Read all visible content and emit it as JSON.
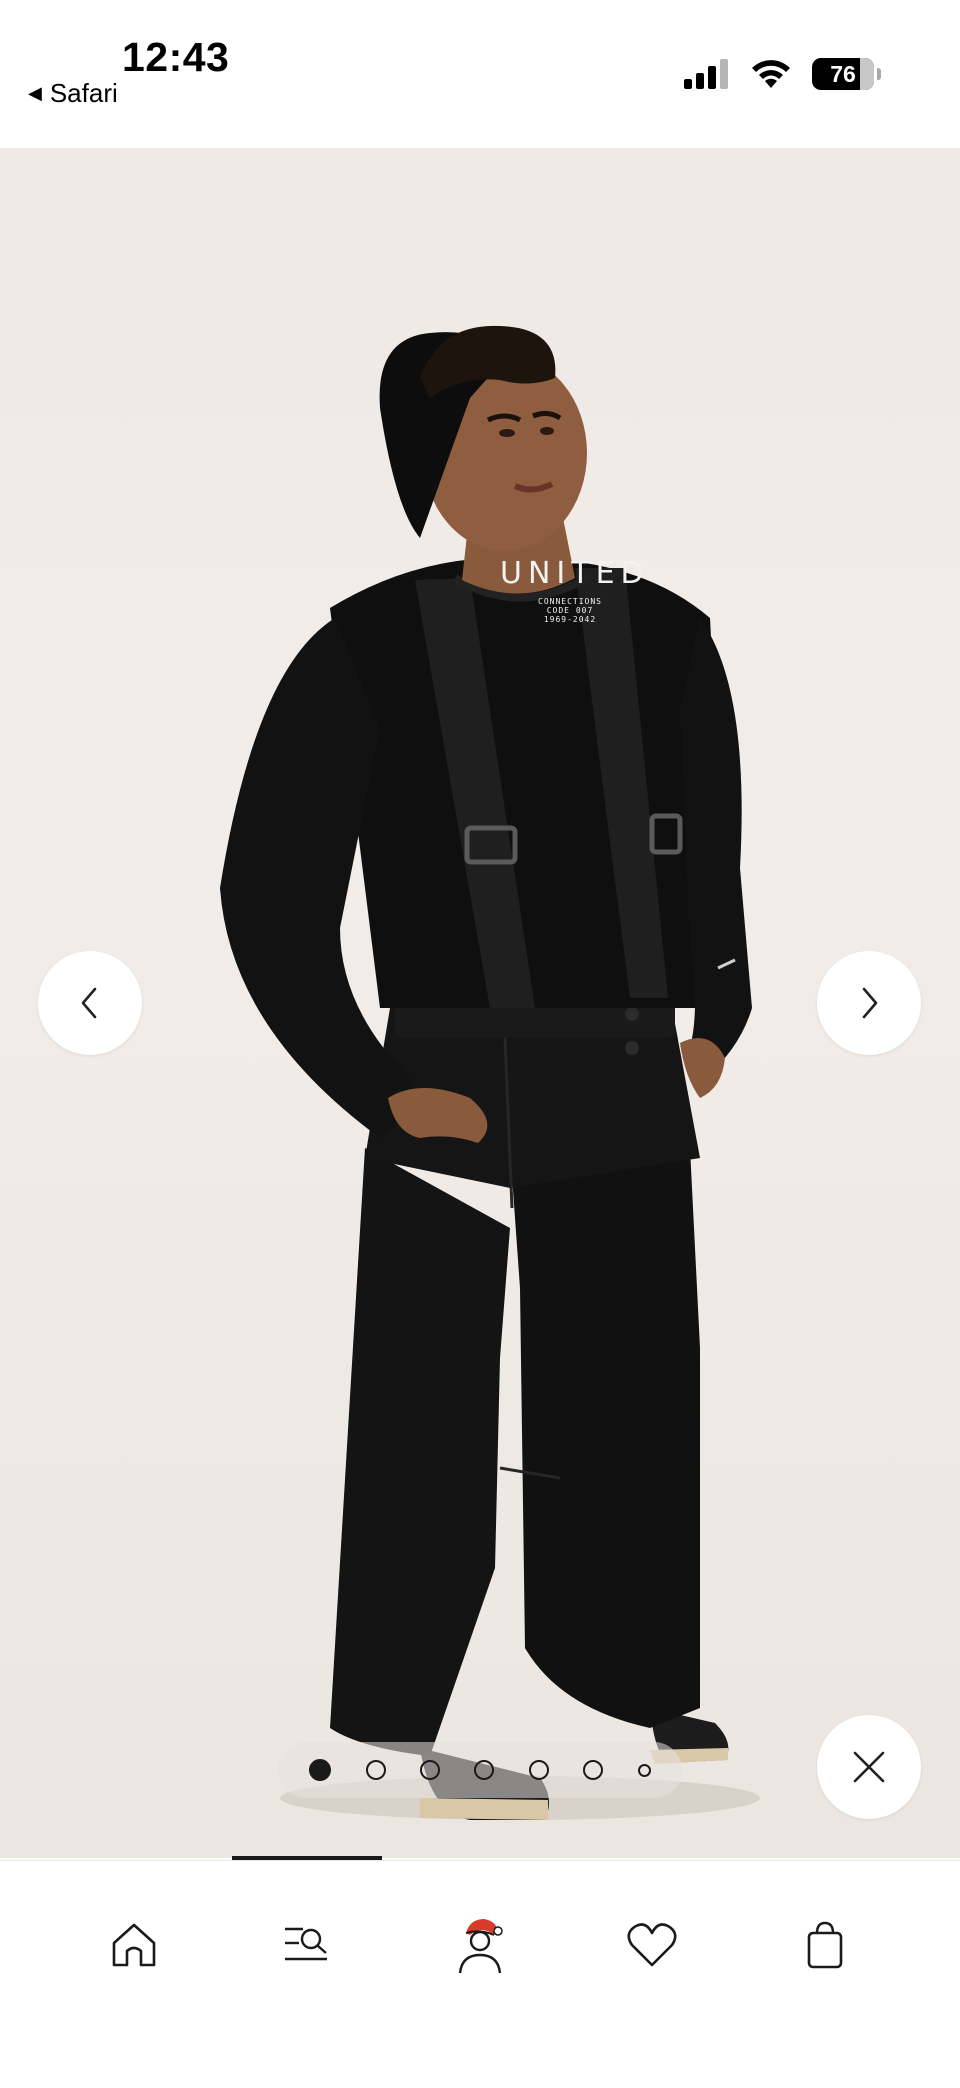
{
  "status_bar": {
    "time": "12:43",
    "back_app_label": "Safari",
    "battery_level": "76",
    "icons": [
      "cellular-signal-icon",
      "wifi-icon",
      "battery-icon"
    ]
  },
  "gallery": {
    "image_description_icon": "product-photo",
    "print_text": {
      "main": "UNITED",
      "line1": "CONNECTIONS",
      "line2": "CODE 007",
      "line3": "1969-2042"
    },
    "prev_icon": "chevron-left-icon",
    "next_icon": "chevron-right-icon",
    "close_icon": "close-icon",
    "pager": {
      "total": 7,
      "active_index": 0
    }
  },
  "bottom_nav": {
    "items": [
      {
        "icon": "home-icon"
      },
      {
        "icon": "search-menu-icon"
      },
      {
        "icon": "profile-santa-icon"
      },
      {
        "icon": "heart-icon"
      },
      {
        "icon": "shopping-bag-icon"
      }
    ],
    "active_index": 1
  },
  "colors": {
    "background": "#efe9e4",
    "garment": "#111111",
    "accent_red": "#d93b2b"
  }
}
